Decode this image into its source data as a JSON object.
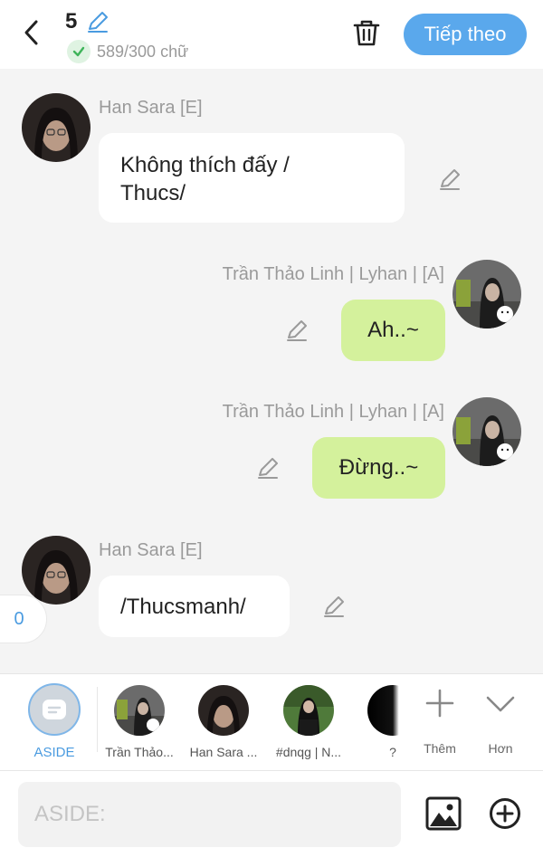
{
  "header": {
    "chapter_number": "5",
    "word_count": "589/300 chữ",
    "next_label": "Tiếp theo"
  },
  "messages": [
    {
      "sender": "Han Sara [E]",
      "text": "Không thích đấy /\nThucs/",
      "side": "left"
    },
    {
      "sender": "Trần Thảo Linh | Lyhan | [A]",
      "text": "Ah..~",
      "side": "right"
    },
    {
      "sender": "Trần Thảo Linh | Lyhan | [A]",
      "text": "Đừng..~",
      "side": "right"
    },
    {
      "sender": "Han Sara [E]",
      "text": "/Thucsmanh/",
      "side": "left"
    }
  ],
  "side_badge": "0",
  "character_bar": {
    "aside_label": "ASIDE",
    "characters": [
      {
        "name": "Trần Thảo..."
      },
      {
        "name": "Han Sara ..."
      },
      {
        "name": "#dnqg | N..."
      },
      {
        "name": "?"
      }
    ],
    "add_label": "Thêm",
    "more_label": "Hơn"
  },
  "input": {
    "placeholder": "ASIDE:",
    "value": ""
  },
  "colors": {
    "accent": "#5aa8ec",
    "right_bubble": "#d4f19c",
    "left_bubble": "#ffffff",
    "background": "#f4f4f4"
  }
}
